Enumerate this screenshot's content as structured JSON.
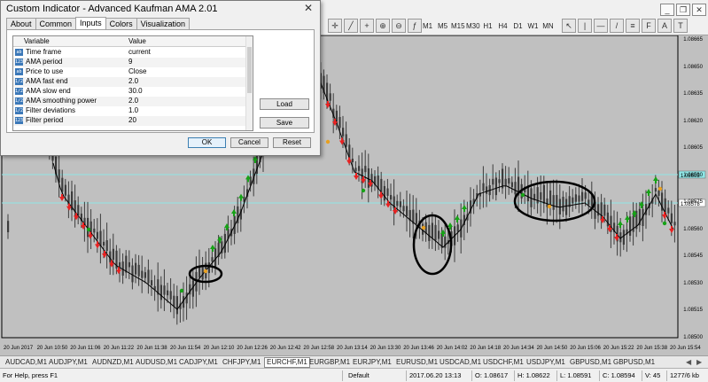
{
  "toolbar": {
    "timeframes": [
      "M1",
      "M5",
      "M15",
      "M30",
      "H1",
      "H4",
      "D1",
      "W1",
      "MN"
    ]
  },
  "dialog": {
    "title": "Custom Indicator - Advanced Kaufman AMA 2.01",
    "tabs": [
      "About",
      "Common",
      "Inputs",
      "Colors",
      "Visualization"
    ],
    "active_tab": "Inputs",
    "grid_headers": {
      "variable": "Variable",
      "value": "Value"
    },
    "params": [
      {
        "icon": "abc-icon",
        "icon_text": "ab",
        "name": "Time frame",
        "value": "current"
      },
      {
        "icon": "int-icon",
        "icon_text": "123",
        "name": "AMA period",
        "value": "9"
      },
      {
        "icon": "abc-icon",
        "icon_text": "ab",
        "name": "Price to use",
        "value": "Close"
      },
      {
        "icon": "double-icon",
        "icon_text": "1/2",
        "name": "AMA fast end",
        "value": "2.0"
      },
      {
        "icon": "double-icon",
        "icon_text": "1/2",
        "name": "AMA slow end",
        "value": "30.0"
      },
      {
        "icon": "double-icon",
        "icon_text": "1/2",
        "name": "AMA smoothing power",
        "value": "2.0"
      },
      {
        "icon": "double-icon",
        "icon_text": "1/2",
        "name": "Filter deviations",
        "value": "1.0"
      },
      {
        "icon": "int-icon",
        "icon_text": "123",
        "name": "Filter period",
        "value": "20"
      }
    ],
    "load_label": "Load",
    "save_label": "Save",
    "ok_label": "OK",
    "cancel_label": "Cancel",
    "reset_label": "Reset"
  },
  "price_axis": {
    "labels": [
      "1.08665",
      "1.08650",
      "1.08635",
      "1.08620",
      "1.08605",
      "1.08590",
      "1.08575",
      "1.08560",
      "1.08545",
      "1.08530",
      "1.08515",
      "1.08500"
    ],
    "marker_upper": "1.08605",
    "marker_lower": "1.08578"
  },
  "time_axis": {
    "labels": [
      "20 Jun 2017",
      "20 Jun 10:50",
      "20 Jun 11:06",
      "20 Jun 11:22",
      "20 Jun 11:38",
      "20 Jun 11:54",
      "20 Jun 12:10",
      "20 Jun 12:26",
      "20 Jun 12:42",
      "20 Jun 12:58",
      "20 Jun 13:14",
      "20 Jun 13:30",
      "20 Jun 13:46",
      "20 Jun 14:02",
      "20 Jun 14:18",
      "20 Jun 14:34",
      "20 Jun 14:50",
      "20 Jun 15:06",
      "20 Jun 15:22",
      "20 Jun 15:38",
      "20 Jun 15:54"
    ]
  },
  "symbol_tabs": {
    "items": [
      "AUDCAD,M1",
      "AUDJPY,M1",
      "AUDNZD,M1",
      "AUDUSD,M1",
      "CADJPY,M1",
      "CHFJPY,M1",
      "EURCHF,M1",
      "EURGBP,M1",
      "EURJPY,M1",
      "EURUSD,M1",
      "USDCAD,M1",
      "USDCHF,M1",
      "USDJPY,M1",
      "GBPUSD,M1",
      "GBPUSD,M1"
    ],
    "active": "EURCHF,M1"
  },
  "status": {
    "help": "For Help, press F1",
    "profile": "Default",
    "time": "2017.06.20 13:13",
    "open": "O: 1.08617",
    "high": "H: 1.08622",
    "low": "L: 1.08591",
    "close": "C: 1.08594",
    "volume": "V: 45",
    "traffic": "1277/6 kb"
  },
  "colors": {
    "chart_bg": "#c0c0c0",
    "candle": "#3c3c3c",
    "arrow_up": "#17a317",
    "arrow_down": "#e82222",
    "ama_line": "#000000",
    "level_line": "#8fe6e6"
  }
}
